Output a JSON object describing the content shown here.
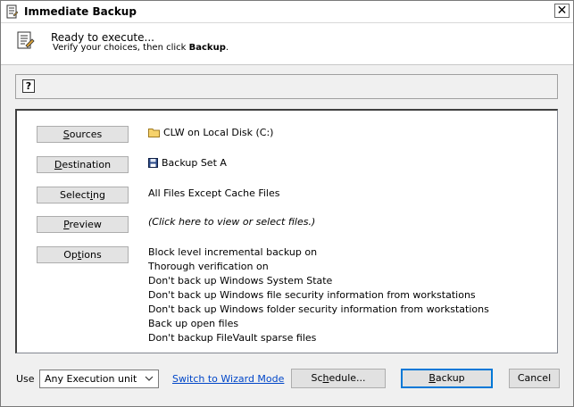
{
  "window": {
    "title": "Immediate Backup",
    "close_glyph": "✕"
  },
  "header": {
    "status_title": "Ready to execute...",
    "status_sub_prefix": "Verify your choices, then click ",
    "status_sub_bold": "Backup",
    "status_sub_suffix": ".",
    "icon": "script-icon"
  },
  "helpbar": {
    "icon_text": "?"
  },
  "sections": {
    "sources": {
      "label_u": "S",
      "label_rest": "ources",
      "value": "CLW on Local Disk (C:)",
      "icon": "folder-icon"
    },
    "destination": {
      "label_u": "D",
      "label_rest": "estination",
      "value": "Backup Set A",
      "icon": "floppy-disk-icon"
    },
    "selecting": {
      "label_pre": "Select",
      "label_u": "i",
      "label_rest": "ng",
      "value": "All Files Except Cache Files"
    },
    "preview": {
      "label_u": "P",
      "label_rest": "review",
      "value": "(Click here to view or select files.)"
    },
    "options": {
      "label_pre": "Op",
      "label_u": "t",
      "label_rest": "ions"
    }
  },
  "options_list": [
    "Block level incremental backup on",
    "Thorough verification on",
    "Don't back up Windows System State",
    "Don't back up Windows file security information from workstations",
    "Don't back up Windows folder security information from workstations",
    "Back up open files",
    "Don't backup FileVault sparse files"
  ],
  "footer": {
    "use_label": "Use",
    "execution_unit": "Any Execution unit",
    "wizard_link": "Switch to Wizard Mode",
    "schedule": {
      "pre": "Sc",
      "u": "h",
      "rest": "edule..."
    },
    "backup": {
      "u": "B",
      "rest": "ackup"
    },
    "cancel": "Cancel"
  },
  "colors": {
    "link": "#0046c8",
    "folder": "#f6d26b",
    "floppy": "#2a4a8a",
    "default_button_border": "#0078d7"
  }
}
